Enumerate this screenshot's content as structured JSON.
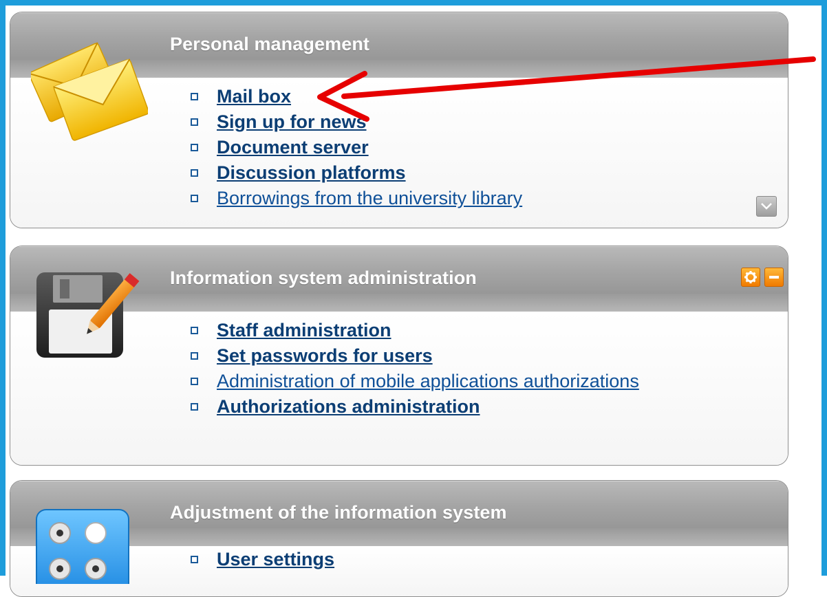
{
  "panels": [
    {
      "title": "Personal management",
      "icon": "envelope-icon",
      "links": [
        {
          "label": "Mail box",
          "bold": true
        },
        {
          "label": "Sign up for news",
          "bold": true
        },
        {
          "label": "Document server",
          "bold": true
        },
        {
          "label": "Discussion platforms",
          "bold": true
        },
        {
          "label": "Borrowings from the university library",
          "bold": false
        }
      ],
      "controls": [
        "chevron-down-icon"
      ]
    },
    {
      "title": "Information system administration",
      "icon": "floppy-disk-pencil-icon",
      "links": [
        {
          "label": "Staff administration",
          "bold": true
        },
        {
          "label": "Set passwords for users",
          "bold": true
        },
        {
          "label": "Administration of mobile applications authorizations",
          "bold": false
        },
        {
          "label": "Authorizations administration",
          "bold": true
        }
      ],
      "controls": [
        "gear-icon",
        "minus-icon"
      ]
    },
    {
      "title": "Adjustment of the information system",
      "icon": "settings-switches-icon",
      "links": [
        {
          "label": "User settings",
          "bold": true
        }
      ]
    }
  ],
  "annotation": {
    "type": "arrow",
    "color": "#e60000",
    "points_to": "Mail box"
  },
  "colors": {
    "frame": "#1e9ddb",
    "link": "#0f5098",
    "link_bold": "#0c3e74",
    "header": "#a4a4a4",
    "accent": "#f07a00"
  }
}
